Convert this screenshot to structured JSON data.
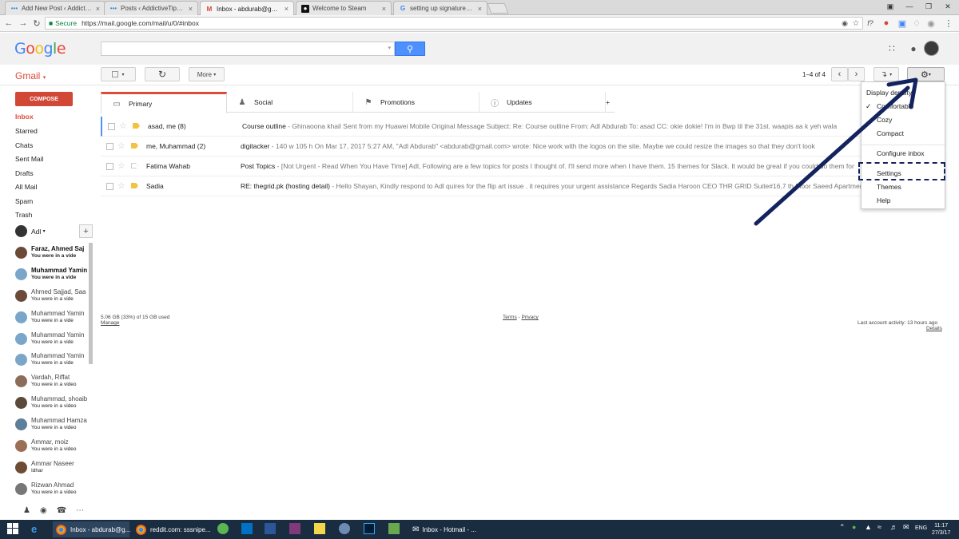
{
  "browser": {
    "tabs": [
      {
        "title": "Add New Post ‹ Addictive",
        "favicon": "wordpress-icon"
      },
      {
        "title": "Posts ‹ AddictiveTips — ",
        "favicon": "wordpress-icon"
      },
      {
        "title": "Inbox - abdurab@gmail.",
        "favicon": "gmail-icon",
        "active": true
      },
      {
        "title": "Welcome to Steam",
        "favicon": "steam-icon"
      },
      {
        "title": "setting up signatures fo",
        "favicon": "google-icon"
      }
    ],
    "secure_label": "Secure",
    "url": "https://mail.google.com/mail/u/0/#inbox"
  },
  "gmail": {
    "logo": "Google",
    "app_label": "Gmail",
    "toolbar": {
      "more_label": "More",
      "paging": "1–4 of 4"
    },
    "compose_label": "COMPOSE",
    "nav": [
      "Inbox",
      "Starred",
      "Chats",
      "Sent Mail",
      "Drafts",
      "All Mail",
      "Spam",
      "Trash"
    ],
    "chat_user": "Adl",
    "contacts": [
      {
        "name": "Faraz, Ahmed Saj",
        "status": "You were in a vide",
        "bold": true
      },
      {
        "name": "Muhammad Yamin",
        "status": "You were in a vide",
        "bold": true
      },
      {
        "name": "Ahmed Sajjad, Saa",
        "status": "You were in a vide"
      },
      {
        "name": "Muhammad Yamin",
        "status": "You were in a vide"
      },
      {
        "name": "Muhammad Yamin",
        "status": "You were in a vide"
      },
      {
        "name": "Muhammad Yamin",
        "status": "You were in a vide"
      },
      {
        "name": "Vardah, Riffat",
        "status": "You were in a video"
      },
      {
        "name": "Muhammad, shoaib",
        "status": "You were in a video"
      },
      {
        "name": "Muhammad Hamza",
        "status": "You were in a video"
      },
      {
        "name": "Ammar, moiz",
        "status": "You were in a video"
      },
      {
        "name": "Ammar Naseer",
        "status": "Idhar"
      },
      {
        "name": "Rizwan Ahmad",
        "status": "You were in a video"
      }
    ],
    "category_tabs": [
      "Primary",
      "Social",
      "Promotions",
      "Updates"
    ],
    "emails": [
      {
        "from": "asad, me (8)",
        "subject": "Course outline",
        "snippet": " - Ghinaoona khail Sent from my Huawei Mobile Original Message Subject: Re: Course outline From: Adl Abdurab To: asad CC: okie dokie! I'm in Bwp til the 31st. waapis aa k yeh wala"
      },
      {
        "from": "me, Muhammad (2)",
        "subject": "digitacker",
        "snippet": " - 140 w 105 h On Mar 17, 2017 5:27 AM, \"Adl Abdurab\" <abdurab@gmail.com> wrote: Nice work with the logos on the site. Maybe we could resize the images so that they don't look"
      },
      {
        "from": "Fatima Wahab",
        "subject": "Post Topics",
        "snippet": " - [Not Urgent - Read When You Have Time] Adl, Following are a few topics for posts I thought of. I'll send more when I have them. 15 themes for Slack. It would be great if you could do them for"
      },
      {
        "from": "Sadia",
        "subject": "RE: thegrid.pk (hosting detail)",
        "snippet": " - Hello Shayan, Kindly respond to Adl quires for the flip art issue . it requires your urgent assistance Regards Sadia Haroon CEO THR GRID Suite#16,7 th Floor Saeed Apartments, Bahria"
      }
    ],
    "footer": {
      "storage": "5.06 GB (33%) of 15 GB used",
      "manage": "Manage",
      "terms": "Terms",
      "privacy": "Privacy",
      "activity": "Last account activity: 13 hours ago",
      "details": "Details"
    },
    "settings_menu": {
      "header": "Display density:",
      "items": [
        "Comfortable",
        "Cozy",
        "Compact",
        "Configure inbox",
        "Settings",
        "Themes",
        "Help"
      ],
      "checked": "Comfortable"
    }
  },
  "taskbar": {
    "apps": [
      {
        "label": "Inbox - abdurab@g...",
        "color": "#e0a030"
      },
      {
        "label": "reddit.com: sssnipe...",
        "color": "#e0a030"
      },
      {
        "label": "Inbox - Hotmail - ...",
        "color": "#ffffff"
      }
    ],
    "lang": "ENG",
    "time": "11:17",
    "date": "27/3/17"
  },
  "colors": {
    "accent_red": "#dd4b39",
    "compose_red": "#d14836",
    "search_blue": "#4d90fe",
    "annotation_navy": "#12235e"
  }
}
